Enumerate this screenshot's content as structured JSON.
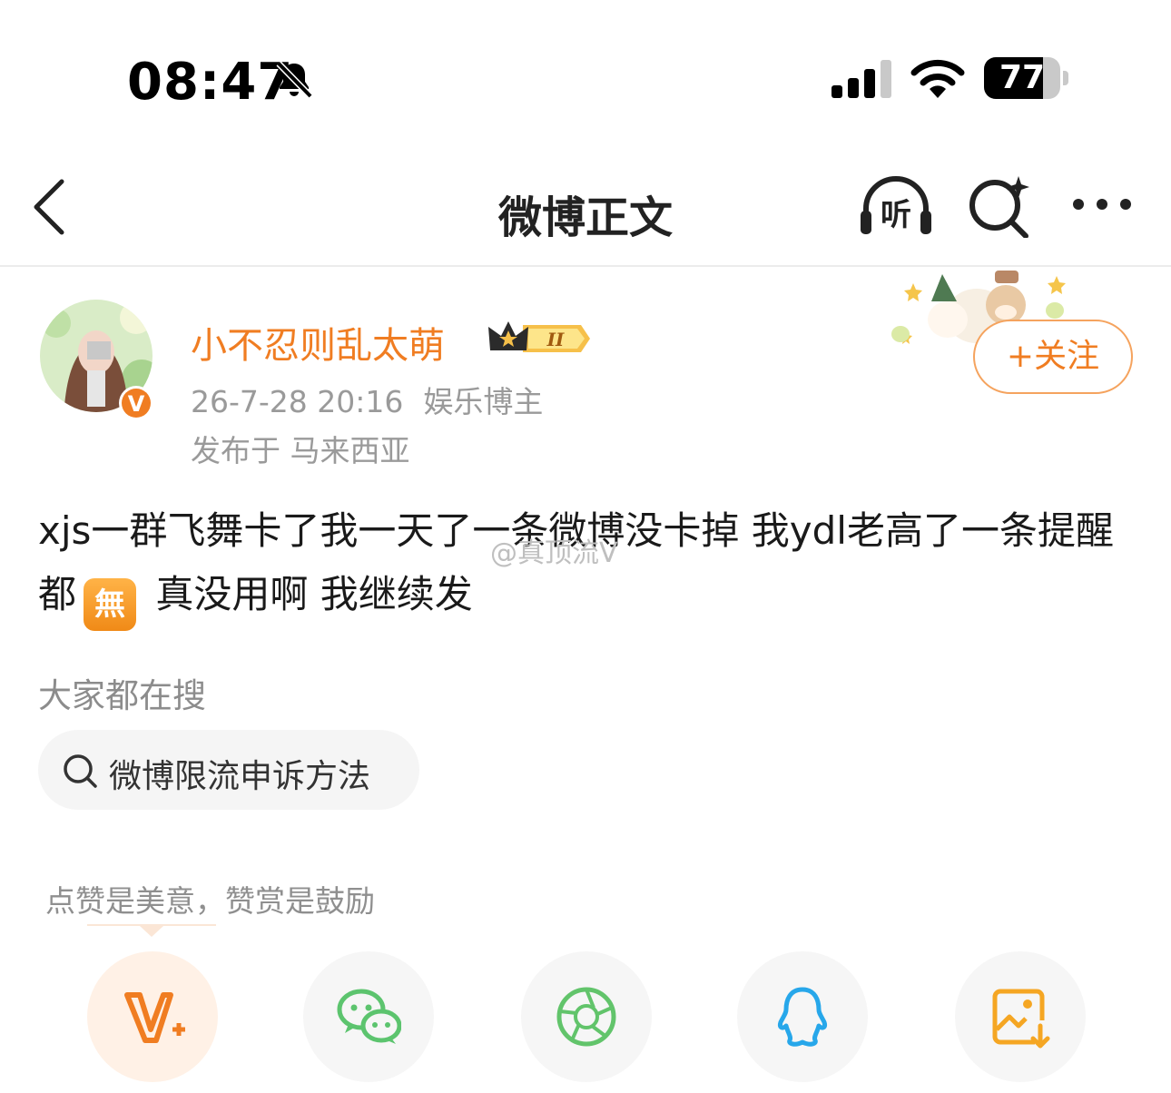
{
  "status_bar": {
    "time": "08:47",
    "battery": "77",
    "battery_level": 0.77,
    "icons": [
      "bell-muted-icon",
      "signal-icon",
      "wifi-icon",
      "battery-icon"
    ]
  },
  "nav": {
    "title": "微博正文",
    "listen_label": "听",
    "icons": [
      "back-icon",
      "listen-icon",
      "search-ai-icon",
      "more-icon"
    ]
  },
  "post": {
    "user_name": "小不忍则乱太萌",
    "vip_level": "II",
    "date": "26-7-28 20:16",
    "user_tag": "娱乐博主",
    "location": "发布于 马来西亚",
    "follow_label": "+关注",
    "text_part1": "xjs一群飞舞卡了我一天了一条微博没卡掉 我ydl老高了一条提醒都",
    "emoji": "無",
    "text_part2": " 真没用啊 我继续发",
    "watermark": "@真顶流V"
  },
  "hot_search": {
    "title": "大家都在搜",
    "item": "微博限流申诉方法"
  },
  "reward": {
    "tip": "点赞是美意，赞赏是鼓励"
  },
  "share": {
    "buttons": [
      "v-plus-icon",
      "wechat-icon",
      "moments-icon",
      "qq-icon",
      "save-image-icon"
    ]
  },
  "colors": {
    "accent": "#f07d22",
    "wechat": "#5cc46e",
    "moments": "#62c46b",
    "qq": "#27a7ea"
  }
}
